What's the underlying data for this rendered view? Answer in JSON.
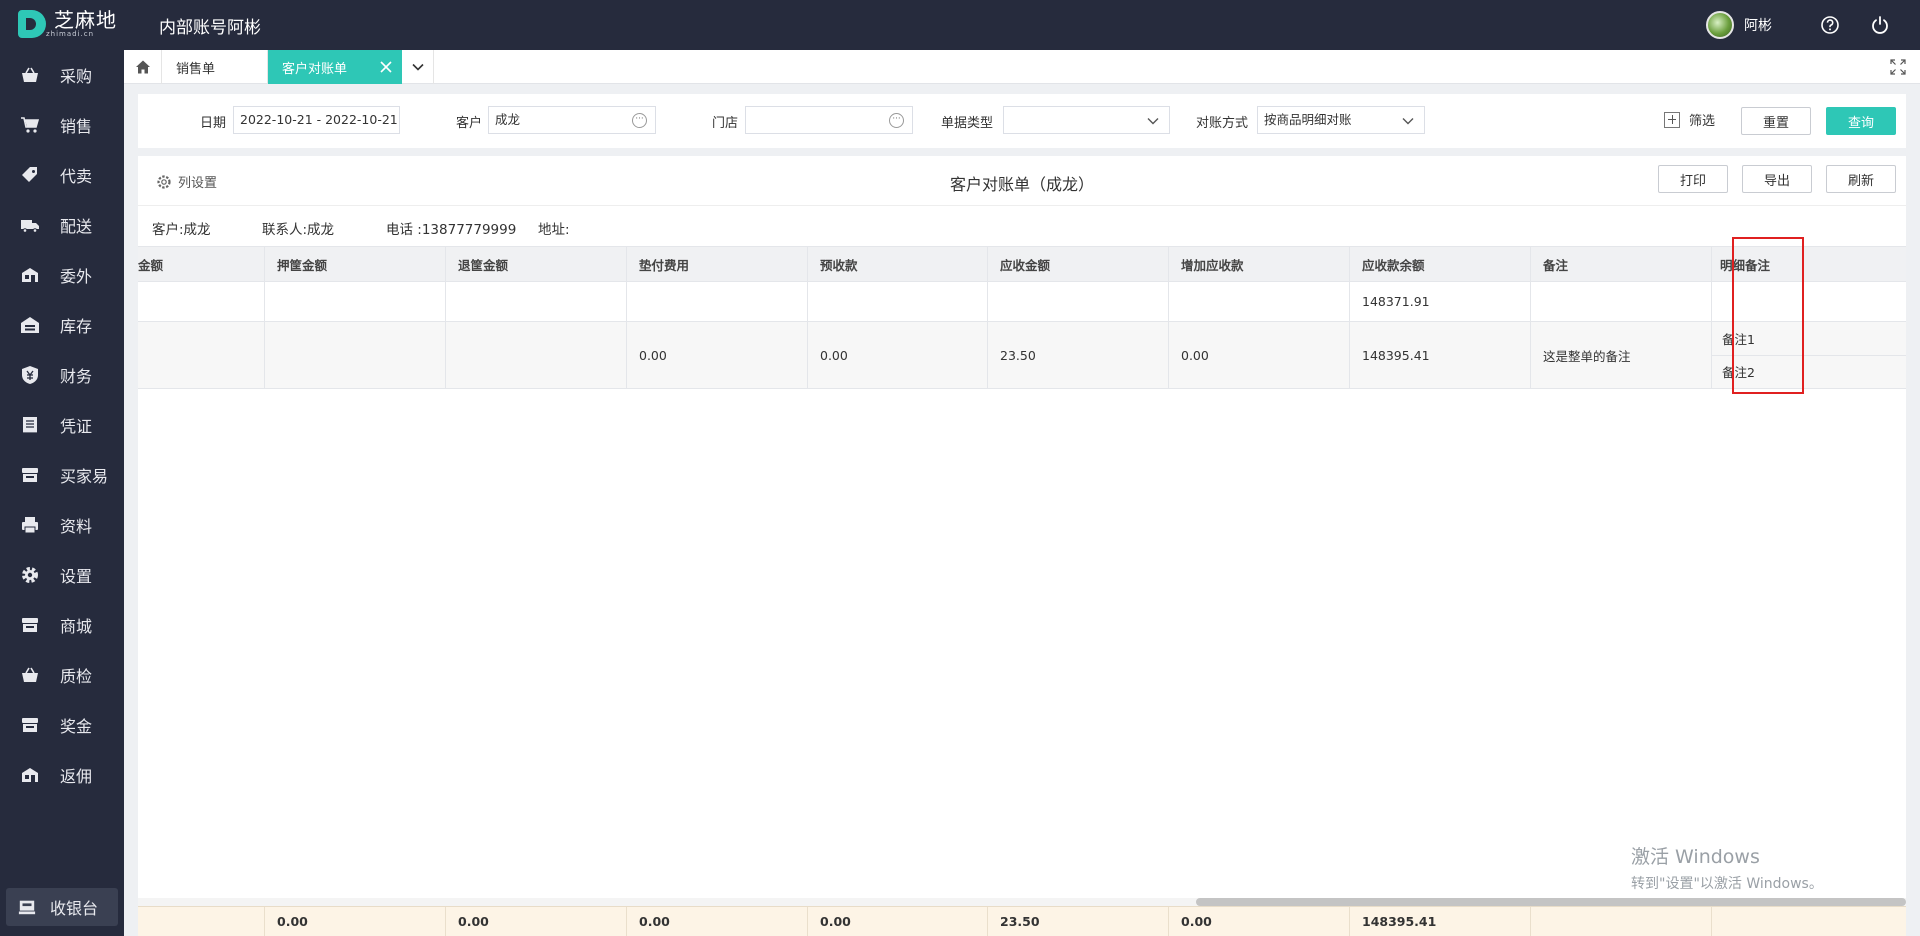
{
  "app": {
    "logo_text": "芝麻地",
    "logo_sub": "zhimadi.cn",
    "title": "内部账号阿彬",
    "user_name": "阿彬"
  },
  "sidebar": {
    "items": [
      {
        "label": "采购",
        "icon": "basket-icon"
      },
      {
        "label": "销售",
        "icon": "cart-icon"
      },
      {
        "label": "代卖",
        "icon": "tag-icon"
      },
      {
        "label": "配送",
        "icon": "truck-icon"
      },
      {
        "label": "委外",
        "icon": "outsource-icon"
      },
      {
        "label": "库存",
        "icon": "warehouse-icon"
      },
      {
        "label": "财务",
        "icon": "finance-icon"
      },
      {
        "label": "凭证",
        "icon": "voucher-icon"
      },
      {
        "label": "买家易",
        "icon": "store-icon"
      },
      {
        "label": "资料",
        "icon": "printer-icon"
      },
      {
        "label": "设置",
        "icon": "gear-icon"
      },
      {
        "label": "商城",
        "icon": "shop-icon"
      },
      {
        "label": "质检",
        "icon": "basket-icon"
      },
      {
        "label": "奖金",
        "icon": "shop-icon"
      },
      {
        "label": "返佣",
        "icon": "outsource-icon"
      }
    ],
    "cashier_label": "收银台"
  },
  "tabs": [
    {
      "label": "销售单"
    },
    {
      "label": "客户对账单"
    }
  ],
  "filters": {
    "date_label": "日期",
    "date_value": "2022-10-21 - 2022-10-21",
    "customer_label": "客户",
    "customer_value": "成龙",
    "store_label": "门店",
    "store_value": "",
    "doc_type_label": "单据类型",
    "doc_type_value": "",
    "recon_label": "对账方式",
    "recon_value": "按商品明细对账",
    "filter_toggle": "筛选",
    "reset": "重置",
    "query": "查询"
  },
  "toolbar": {
    "column_settings": "列设置",
    "doc_title": "客户对账单（成龙）",
    "print": "打印",
    "export": "导出",
    "refresh": "刷新"
  },
  "info": {
    "customer": "客户:成龙",
    "contact": "联系人:成龙",
    "phone": "电话 :13877779999",
    "address": "地址:"
  },
  "table": {
    "columns": [
      "金额",
      "押筐金额",
      "退筐金额",
      "垫付费用",
      "预收款",
      "应收金额",
      "增加应收款",
      "应收款余额",
      "备注",
      "明细备注"
    ],
    "rows": [
      [
        "",
        "",
        "",
        "",
        "",
        "",
        "",
        "148371.91",
        "",
        ""
      ],
      [
        "",
        "",
        "",
        "0.00",
        "0.00",
        "23.50",
        "0.00",
        "148395.41",
        "这是整单的备注",
        ""
      ]
    ],
    "detail_notes": [
      "备注1",
      "备注2"
    ],
    "totals": [
      "",
      "0.00",
      "0.00",
      "0.00",
      "0.00",
      "23.50",
      "0.00",
      "148395.41",
      "",
      ""
    ]
  },
  "watermark": {
    "line1": "激活 Windows",
    "line2": "转到\"设置\"以激活 Windows。"
  },
  "colors": {
    "accent": "#2ec7b6",
    "sidebar_bg": "#262b3d",
    "highlight": "#e02020",
    "footer_bg": "#fdf4e6"
  }
}
